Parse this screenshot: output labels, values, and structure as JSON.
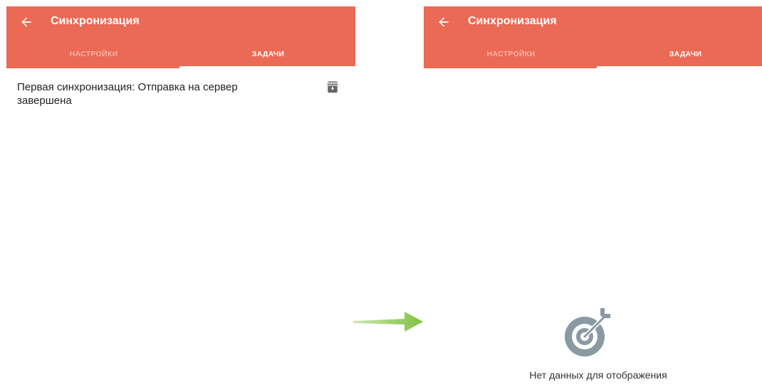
{
  "colors": {
    "appbar": "#ea6a55",
    "tab_inactive": "#f2b3a8",
    "arrow": "#7dc242",
    "icon_gray": "#8a9aa3"
  },
  "left": {
    "header": {
      "title": "Синхронизация",
      "back_icon": "back-arrow-icon"
    },
    "tabs": [
      {
        "label": "НАСТРОЙКИ",
        "active": false
      },
      {
        "label": "ЗАДАЧИ",
        "active": true
      }
    ],
    "tasks": [
      {
        "text": "Первая синхронизация: Отправка на сервер завершена",
        "icon": "archive-icon"
      }
    ]
  },
  "right": {
    "header": {
      "title": "Синхронизация",
      "back_icon": "back-arrow-icon"
    },
    "tabs": [
      {
        "label": "НАСТРОЙКИ",
        "active": false
      },
      {
        "label": "ЗАДАЧИ",
        "active": true
      }
    ],
    "empty": {
      "icon": "target-icon",
      "text": "Нет данных для отображения"
    }
  },
  "transition_icon": "right-arrow-icon"
}
